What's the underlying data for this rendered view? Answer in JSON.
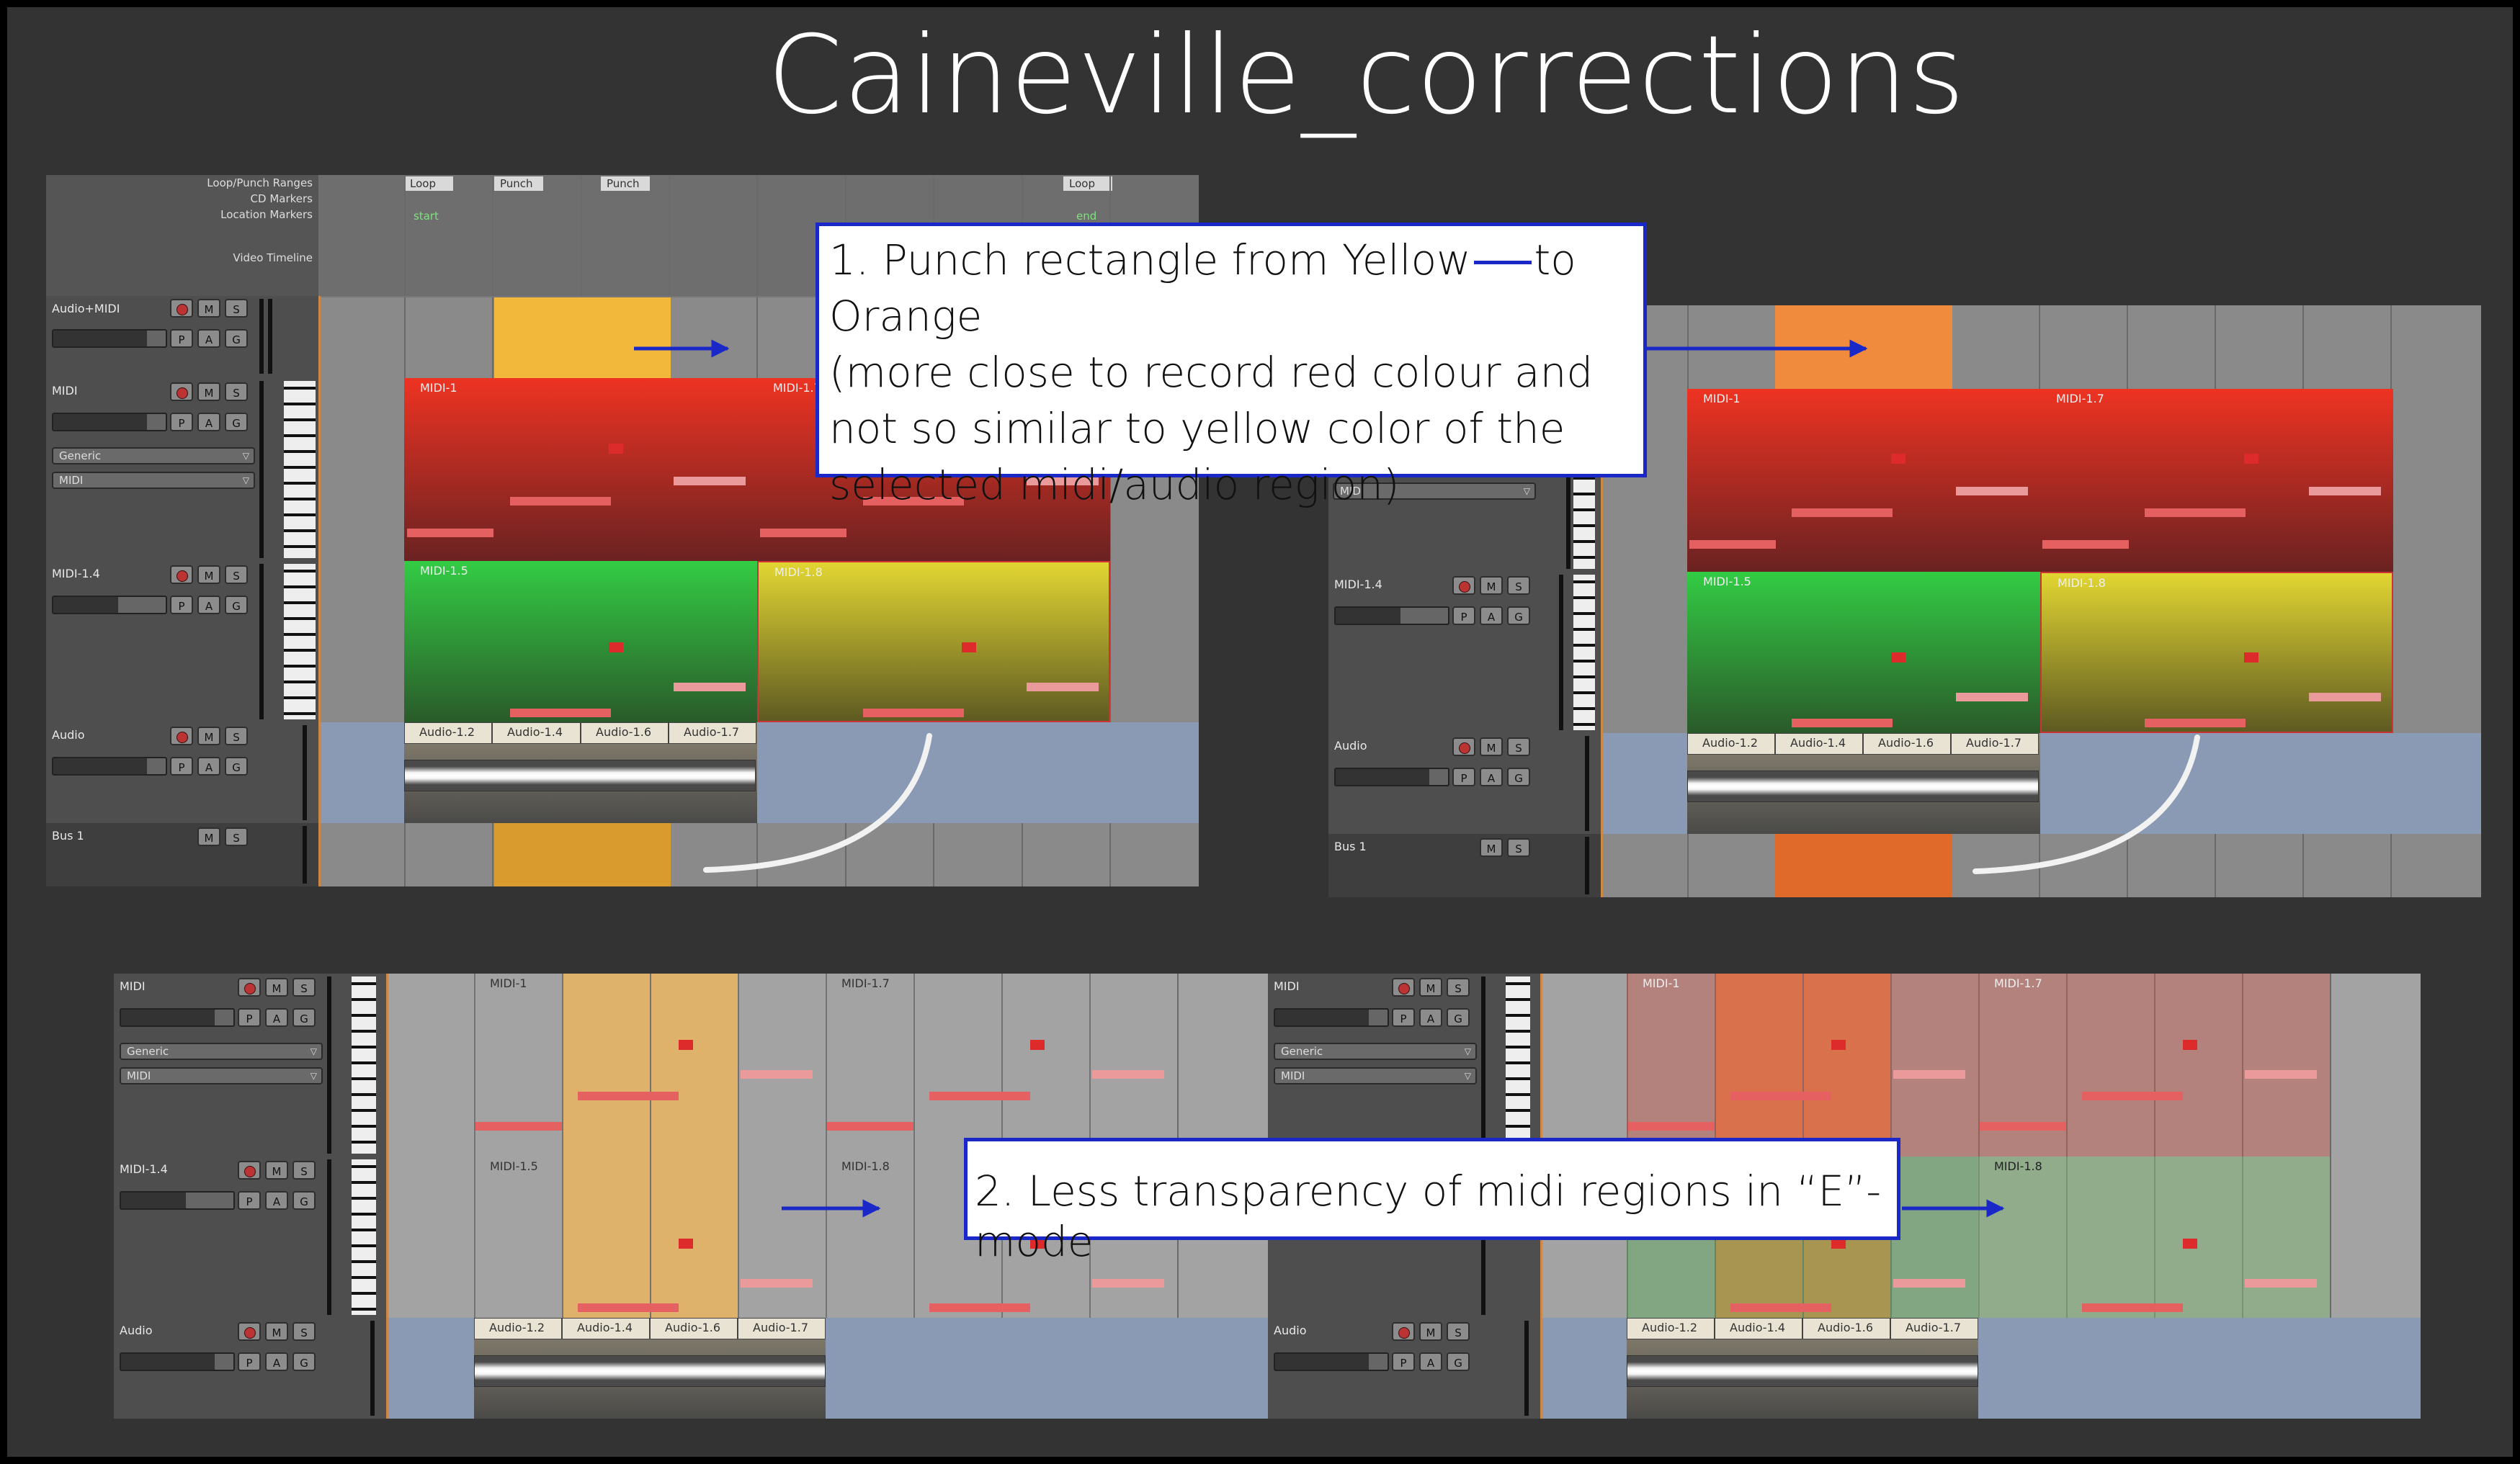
{
  "title": "Caineville_corrections",
  "ruler": {
    "labels": [
      "Loop/Punch Ranges",
      "CD Markers",
      "Location Markers",
      "Video Timeline"
    ],
    "loop_markers": [
      "Loop",
      "Punch",
      "Punch",
      "Loop"
    ],
    "location_markers": [
      "start",
      "end"
    ]
  },
  "tracks": {
    "audio_midi": "Audio+MIDI",
    "midi": "MIDI",
    "midi14": "MIDI-1.4",
    "audio": "Audio",
    "bus": "Bus 1"
  },
  "buttons": {
    "m": "M",
    "s": "S",
    "p": "P",
    "a": "A",
    "g": "G"
  },
  "dropdowns": {
    "generic": "Generic",
    "midi": "MIDI"
  },
  "regions": {
    "midi1": "MIDI-1",
    "midi17": "MIDI-1.7",
    "midi15": "MIDI-1.5",
    "midi18": "MIDI-1.8",
    "a12": "Audio-1.2",
    "a14": "Audio-1.4",
    "a16": "Audio-1.6",
    "a17": "Audio-1.7"
  },
  "callouts": {
    "one": [
      "1. Punch rectangle from Yellow",
      "to Orange",
      "(more close to record red colour and",
      "not so similar to yellow color of the",
      "selected midi/audio region)"
    ],
    "two": "2.  Less transparency of midi regions in “E”-mode"
  },
  "colors": {
    "punch_yellow": "#f2b83c",
    "punch_orange": "#f08a3c",
    "callout_border": "#1a28c8",
    "midi_red": "#dd3322",
    "midi_green": "#33c040",
    "midi_yellow": "#d8cc2e"
  }
}
